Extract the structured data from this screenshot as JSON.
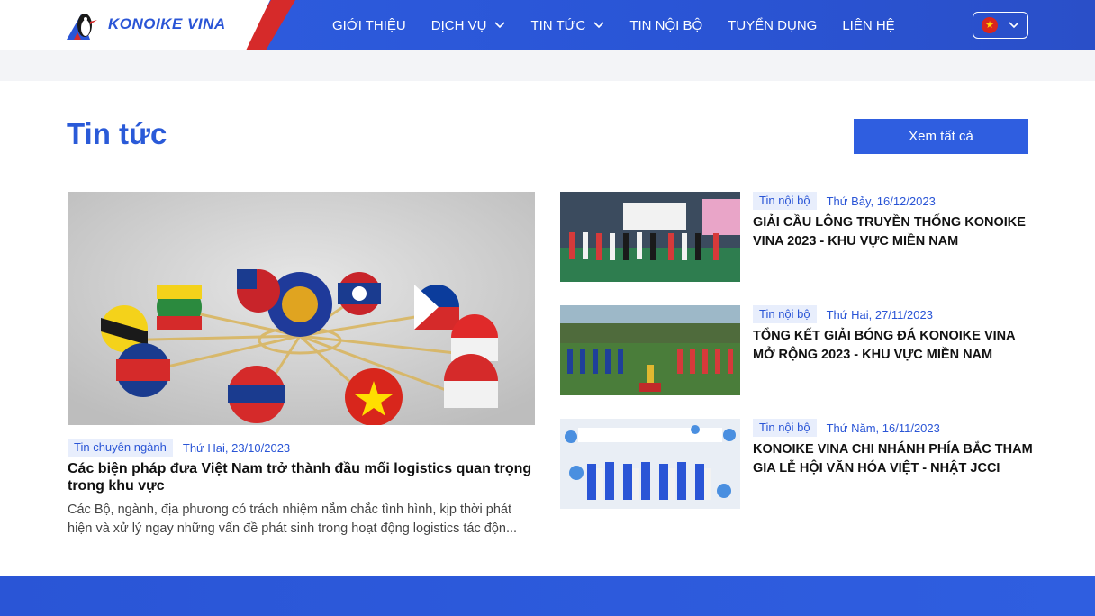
{
  "header": {
    "brand": "KONOIKE VINA",
    "nav": [
      {
        "label": "GIỚI THIỆU",
        "dropdown": false
      },
      {
        "label": "DỊCH VỤ",
        "dropdown": true
      },
      {
        "label": "TIN TỨC",
        "dropdown": true
      },
      {
        "label": "TIN NỘI BỘ",
        "dropdown": false
      },
      {
        "label": "TUYỂN DỤNG",
        "dropdown": false
      },
      {
        "label": "LIÊN HỆ",
        "dropdown": false
      }
    ],
    "language_icon": "vietnam-flag-icon"
  },
  "section": {
    "title": "Tin tức",
    "view_all": "Xem tất cả"
  },
  "featured": {
    "tag": "Tin chuyên ngành",
    "date": "Thứ Hai, 23/10/2023",
    "title": "Các biện pháp đưa Việt Nam trở thành đầu mối logistics quan trọng trong khu vực",
    "excerpt": "Các Bộ, ngành, địa phương có trách nhiệm nắm chắc tình hình, kịp thời phát hiện và xử lý ngay những vấn đề phát sinh trong hoạt động logistics tác độn..."
  },
  "side_news": [
    {
      "tag": "Tin nội bộ",
      "date": "Thứ Bảy, 16/12/2023",
      "title": "GIẢI CẦU LÔNG TRUYỀN THỐNG KONOIKE VINA 2023 - KHU VỰC MIỀN NAM"
    },
    {
      "tag": "Tin nội bộ",
      "date": "Thứ Hai, 27/11/2023",
      "title": "TỔNG KẾT GIẢI BÓNG ĐÁ KONOIKE VINA MỞ RỘNG 2023 - KHU VỰC MIỀN NAM"
    },
    {
      "tag": "Tin nội bộ",
      "date": "Thứ Năm, 16/11/2023",
      "title": "KONOIKE VINA CHI NHÁNH PHÍA BẮC THAM GIA LỄ HỘI VĂN HÓA VIỆT - NHẬT JCCI"
    }
  ],
  "colors": {
    "primary": "#2f5ee0",
    "accent_red": "#d62a2a",
    "tag_bg": "#e8eefc"
  }
}
